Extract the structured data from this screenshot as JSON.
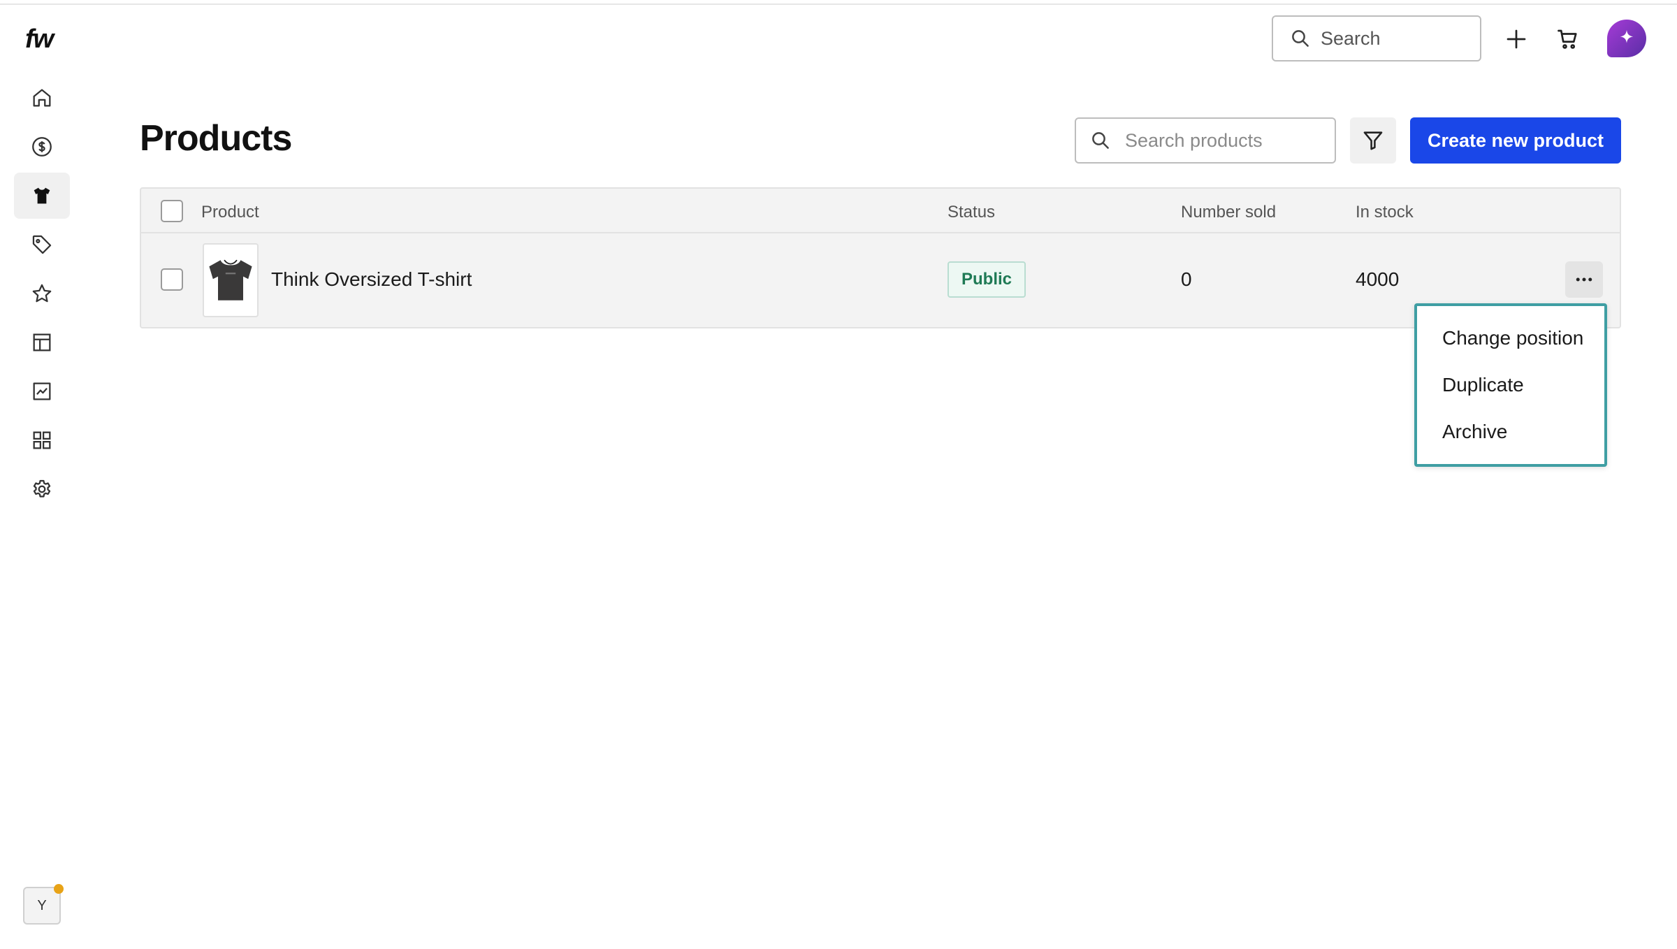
{
  "app": {
    "logo_text": "fw"
  },
  "sidebar": {
    "items": [
      {
        "id": "home",
        "icon": "home-icon"
      },
      {
        "id": "payments",
        "icon": "dollar-circle-icon"
      },
      {
        "id": "products",
        "icon": "tshirt-icon",
        "active": true
      },
      {
        "id": "discounts",
        "icon": "tag-icon"
      },
      {
        "id": "reviews",
        "icon": "star-icon"
      },
      {
        "id": "layout",
        "icon": "table-layout-icon"
      },
      {
        "id": "analytics",
        "icon": "chart-line-icon"
      },
      {
        "id": "apps",
        "icon": "apps-grid-icon"
      },
      {
        "id": "settings",
        "icon": "gear-icon"
      }
    ],
    "user_initial": "Y"
  },
  "topbar": {
    "search_placeholder": "Search"
  },
  "page": {
    "title": "Products",
    "search_placeholder": "Search products",
    "create_label": "Create new product"
  },
  "table": {
    "columns": {
      "product": "Product",
      "status": "Status",
      "sold": "Number sold",
      "stock": "In stock"
    },
    "rows": [
      {
        "name": "Think Oversized T-shirt",
        "status": "Public",
        "sold": "0",
        "stock": "4000"
      }
    ]
  },
  "menu": {
    "items": [
      "Change position",
      "Duplicate",
      "Archive"
    ]
  },
  "colors": {
    "primary": "#1a47e8",
    "status_public_text": "#1f7a55",
    "menu_highlight": "#3f9ea3",
    "ai_badge": "#a53bd6",
    "notification_dot": "#e8a317"
  }
}
